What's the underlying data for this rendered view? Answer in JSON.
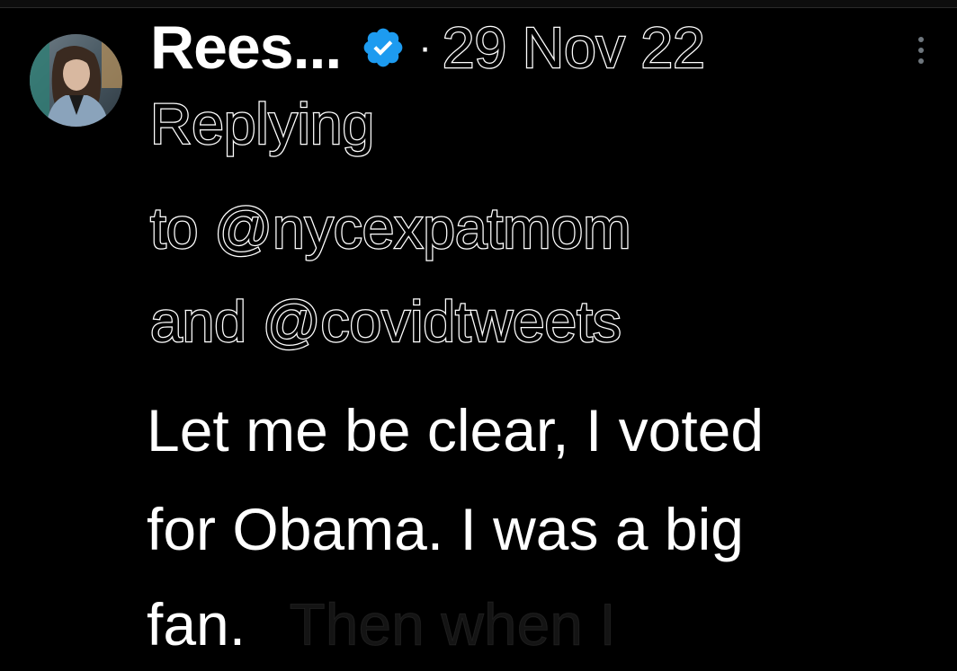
{
  "tweet": {
    "display_name": "Rees...",
    "verified_icon": "verified-badge-icon",
    "separator": "·",
    "date": "29 Nov 22",
    "more_icon": "more-options-icon",
    "reply_line_1": "Replying",
    "reply_line_2": "to @nycexpatmom",
    "reply_line_3": "and @covidtweets",
    "body_line_1": "Let me be clear, I voted",
    "body_line_2": "for Obama. I was a big",
    "body_line_3": "fan.",
    "body_faded": "Then when I"
  },
  "colors": {
    "background": "#000000",
    "text": "#ffffff",
    "verified_blue": "#1d9bf0"
  }
}
